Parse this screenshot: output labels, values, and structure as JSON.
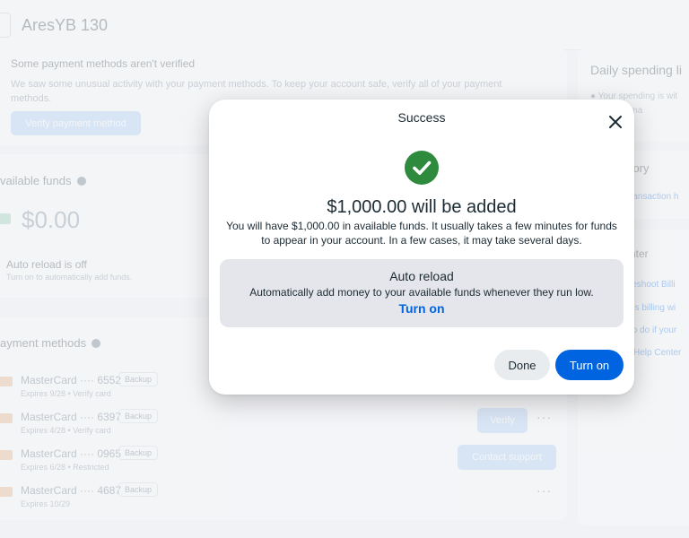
{
  "header": {
    "account_name": "AresYB 130"
  },
  "warning": {
    "title": "Some payment methods aren't verified",
    "text": "We saw some unusual activity with your payment methods. To keep your account safe, verify all of your payment methods.",
    "button": "Verify payment method"
  },
  "funds": {
    "title": "vailable funds",
    "amount": "$0.00",
    "auto_reload_status": "Auto reload is off",
    "auto_reload_sub": "Turn on to automatically add funds."
  },
  "payment_methods": {
    "title": "ayment methods",
    "items": [
      {
        "name": "MasterCard ···· 6552",
        "badge": "Backup",
        "sub": "Expires 9/28 • Verify card"
      },
      {
        "name": "MasterCard ···· 6397",
        "badge": "Backup",
        "sub": "Expires 4/28 • Verify card",
        "action": "Verify"
      },
      {
        "name": "MasterCard ···· 0965",
        "badge": "Backup",
        "sub": "Expires 6/28 • Restricted",
        "action": "Contact support"
      },
      {
        "name": "MasterCard ···· 4687",
        "badge": "Backup",
        "sub": "Expires 10/29"
      }
    ]
  },
  "sidebar": {
    "spending_title": "Daily spending li",
    "spending_text_1": "● Your spending is wit",
    "spending_text_2": "Meta and ma",
    "history_title": "t history",
    "history_link": "ransaction h",
    "help_title": "nter",
    "help_links": [
      "leshoot Billi",
      "ds billing wi",
      "to do if your",
      "Help Center"
    ]
  },
  "modal": {
    "title": "Success",
    "headline": "$1,000.00 will be added",
    "description": "You will have $1,000.00 in available funds. It usually takes a few minutes for funds to appear in your account. In a few cases, it may take several days.",
    "auto_reload": {
      "title": "Auto reload",
      "description": "Automatically add money to your available funds whenever they run low.",
      "link": "Turn on"
    },
    "done_button": "Done",
    "turn_on_button": "Turn on"
  },
  "colors": {
    "accent": "#0064e0",
    "success": "#2e8b3e",
    "reload_bg": "#e4e6eb"
  }
}
